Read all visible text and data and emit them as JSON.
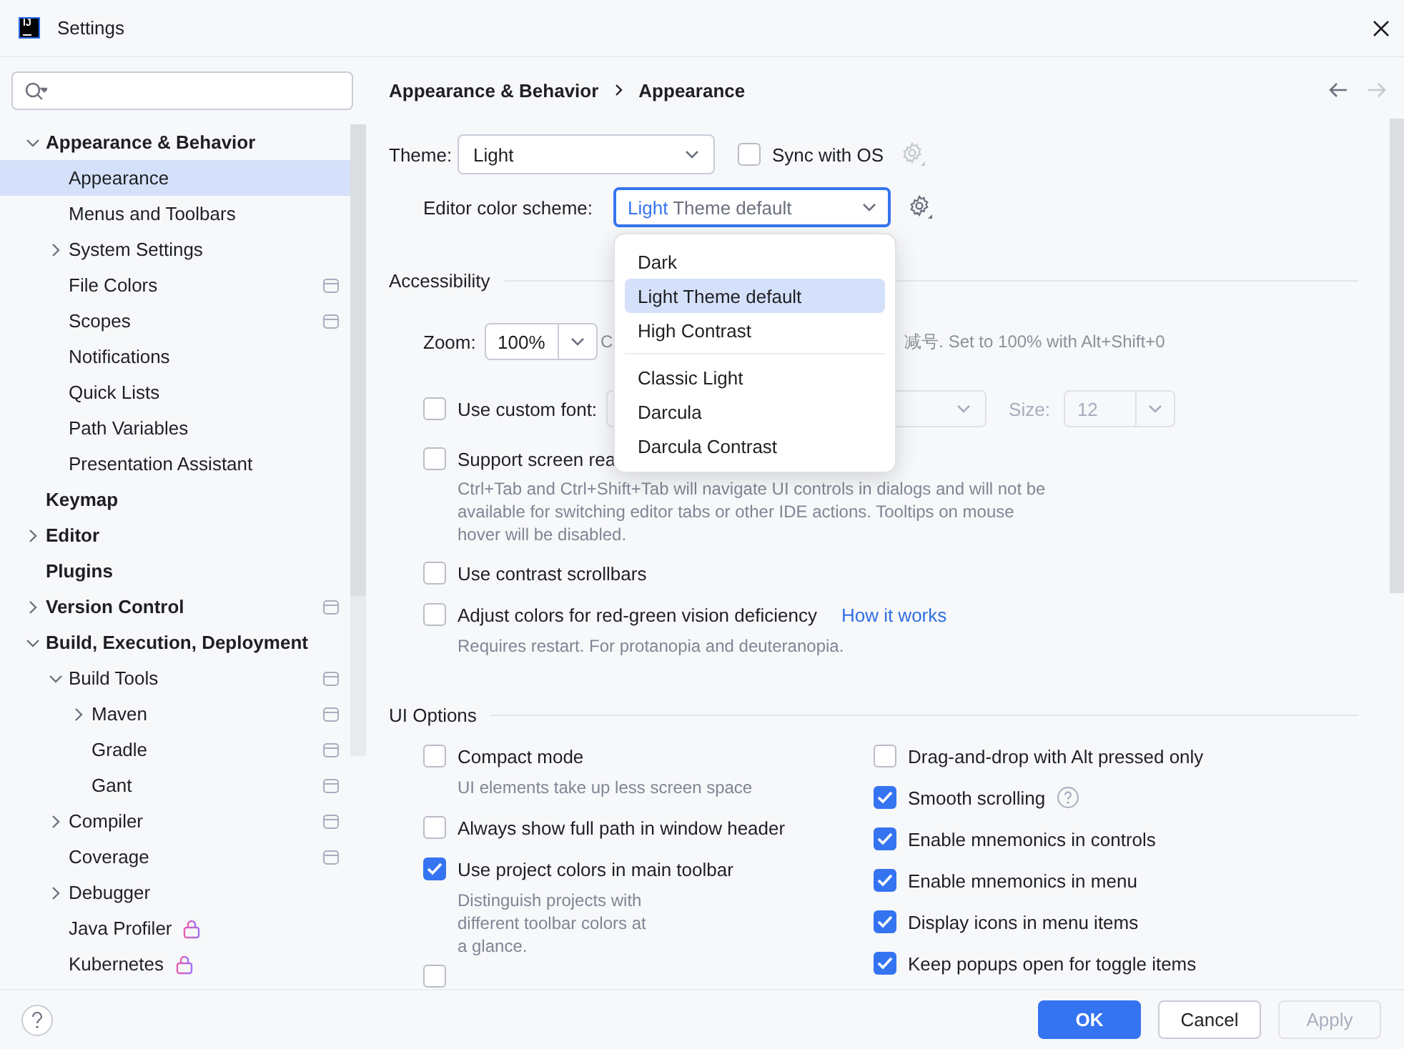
{
  "window": {
    "title": "Settings",
    "logo_text": "IJ"
  },
  "sidebar": {
    "tree": [
      {
        "label": "Appearance & Behavior",
        "kind": "plain",
        "expanded": true,
        "selected": false,
        "children": [
          {
            "label": "Appearance",
            "kind": "plain",
            "selected": true
          },
          {
            "label": "Menus and Toolbars",
            "kind": "plain",
            "selected": false
          },
          {
            "label": "System Settings",
            "kind": "plain",
            "expanded": false,
            "selected": false
          },
          {
            "label": "File Colors",
            "kind": "project",
            "selected": false
          },
          {
            "label": "Scopes",
            "kind": "project",
            "selected": false
          },
          {
            "label": "Notifications",
            "kind": "plain",
            "selected": false
          },
          {
            "label": "Quick Lists",
            "kind": "plain",
            "selected": false
          },
          {
            "label": "Path Variables",
            "kind": "plain",
            "selected": false
          },
          {
            "label": "Presentation Assistant",
            "kind": "plain",
            "selected": false
          }
        ]
      },
      {
        "label": "Keymap",
        "kind": "plain",
        "selected": false
      },
      {
        "label": "Editor",
        "kind": "plain",
        "expanded": false,
        "selected": false
      },
      {
        "label": "Plugins",
        "kind": "plain",
        "selected": false
      },
      {
        "label": "Version Control",
        "kind": "project",
        "expanded": false,
        "selected": false
      },
      {
        "label": "Build, Execution, Deployment",
        "kind": "plain",
        "expanded": true,
        "selected": false,
        "children": [
          {
            "label": "Build Tools",
            "kind": "project",
            "expanded": true,
            "selected": false,
            "children": [
              {
                "label": "Maven",
                "kind": "project",
                "expanded": false,
                "selected": false
              },
              {
                "label": "Gradle",
                "kind": "project",
                "selected": false
              },
              {
                "label": "Gant",
                "kind": "project",
                "selected": false
              }
            ]
          },
          {
            "label": "Compiler",
            "kind": "project",
            "expanded": false,
            "selected": false
          },
          {
            "label": "Coverage",
            "kind": "project",
            "selected": false
          },
          {
            "label": "Debugger",
            "kind": "plain",
            "expanded": false,
            "selected": false
          },
          {
            "label": "Java Profiler",
            "kind": "lock",
            "selected": false
          },
          {
            "label": "Kubernetes",
            "kind": "lock",
            "selected": false
          }
        ]
      }
    ]
  },
  "breadcrumb": [
    "Appearance & Behavior",
    "Appearance"
  ],
  "theme": {
    "label": "Theme:",
    "value": "Light",
    "sync": {
      "label": "Sync with OS",
      "checked": false
    }
  },
  "scheme": {
    "label": "Editor color scheme:",
    "matched": "Light",
    "rest": "Theme default",
    "popup": [
      [
        {
          "label": "Dark",
          "selected": false
        },
        {
          "label": "Light Theme default",
          "selected": true
        },
        {
          "label": "High Contrast",
          "selected": false
        }
      ],
      [
        {
          "label": "Classic Light",
          "selected": false
        },
        {
          "label": "Darcula",
          "selected": false
        },
        {
          "label": "Darcula Contrast",
          "selected": false
        }
      ]
    ]
  },
  "accessibility": {
    "title": "Accessibility",
    "zoom": {
      "label": "Zoom:",
      "value": "100%",
      "hint_left": "C",
      "hint_right": "减号. Set to 100% with Alt+Shift+0"
    },
    "custom_font": {
      "label": "Use custom font:",
      "checked": false,
      "size_label": "Size:",
      "size": "12"
    },
    "options": [
      {
        "label": "Support screen rea",
        "checked": false,
        "description": "Ctrl+Tab and Ctrl+Shift+Tab will navigate UI controls in dialogs and will not be available for switching editor tabs or other IDE actions. Tooltips on mouse hover will be disabled."
      },
      {
        "label": "Use contrast scrollbars",
        "checked": false
      },
      {
        "label": "Adjust colors for red-green vision deficiency",
        "checked": false,
        "link": "How it works",
        "description": "Requires restart. For protanopia and deuteranopia."
      }
    ]
  },
  "ui_options": {
    "title": "UI Options",
    "left": [
      {
        "label": "Compact mode",
        "checked": false,
        "description": "UI elements take up less screen space"
      },
      {
        "label": "Always show full path in window header",
        "checked": false
      },
      {
        "label": "Use project colors in main toolbar",
        "checked": true,
        "description": "Distinguish projects with different toolbar colors at a glance."
      },
      {
        "checked": false
      }
    ],
    "right": [
      {
        "label": "Drag-and-drop with Alt pressed only",
        "checked": false,
        "help_icon": false
      },
      {
        "label": "Smooth scrolling",
        "checked": true,
        "help_icon": true
      },
      {
        "label": "Enable mnemonics in controls",
        "checked": true,
        "help_icon": false
      },
      {
        "label": "Enable mnemonics in menu",
        "checked": true,
        "help_icon": false
      },
      {
        "label": "Display icons in menu items",
        "checked": true,
        "help_icon": false
      },
      {
        "label": "Keep popups open for toggle items",
        "checked": true,
        "help_icon": false
      }
    ]
  },
  "footer": {
    "buttons": [
      {
        "label": "OK",
        "primary": true,
        "disabled": false
      },
      {
        "label": "Cancel",
        "primary": false,
        "disabled": false
      },
      {
        "label": "Apply",
        "primary": false,
        "disabled": true
      }
    ]
  }
}
